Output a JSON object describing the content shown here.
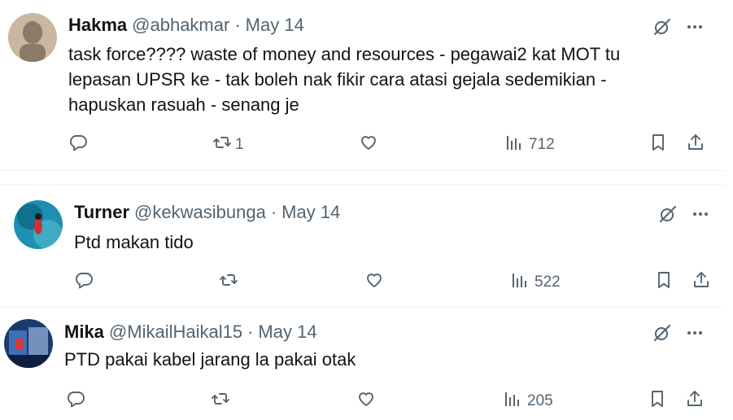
{
  "tweets": [
    {
      "name": "Hakma",
      "handle": "@abhakmar",
      "separator": "·",
      "date": "May 14",
      "text_lines": [
        "task force???? waste of money and resources - pegawai2 kat MOT tu",
        "lepasan UPSR ke - tak boleh nak fikir cara atasi gejala sedemikian -",
        "hapuskan rasuah - senang je"
      ],
      "reply_count": "",
      "retweet_count": "1",
      "like_count": "",
      "view_count": "712",
      "avatar_colors": [
        "#c9b8a0",
        "#8a7a66"
      ]
    },
    {
      "name": "Turner",
      "handle": "@kekwasibunga",
      "separator": "·",
      "date": "May 14",
      "text_lines": [
        "Ptd makan tido"
      ],
      "reply_count": "",
      "retweet_count": "",
      "like_count": "",
      "view_count": "522",
      "avatar_colors": [
        "#1f8fb0",
        "#0b5a78"
      ]
    },
    {
      "name": "Mika",
      "handle": "@MikailHaikal15",
      "separator": "·",
      "date": "May 14",
      "text_lines": [
        "PTD pakai kabel jarang la pakai otak"
      ],
      "reply_count": "",
      "retweet_count": "",
      "like_count": "",
      "view_count": "205",
      "avatar_colors": [
        "#1c3a6e",
        "#3f6fb5"
      ]
    }
  ],
  "icons": {
    "grok": "grok-icon",
    "more": "more-icon",
    "reply": "reply-icon",
    "retweet": "retweet-icon",
    "like": "like-icon",
    "views": "views-icon",
    "bookmark": "bookmark-icon",
    "share": "share-icon"
  },
  "colors": {
    "text": "#0f1419",
    "muted": "#536471",
    "divider": "#eff3f4"
  }
}
